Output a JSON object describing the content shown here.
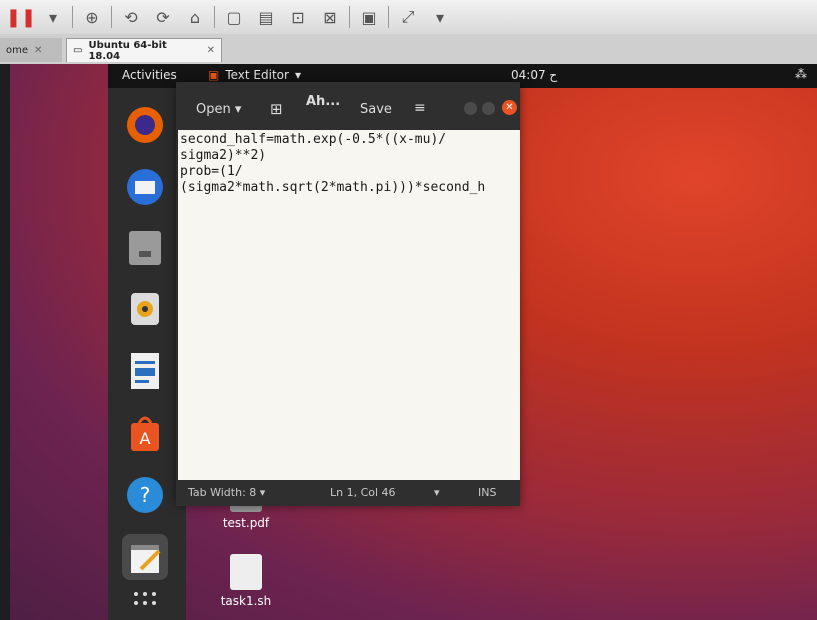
{
  "vmware": {
    "tabs": [
      {
        "label": "ome"
      },
      {
        "label": "Ubuntu 64-bit 18.04"
      }
    ]
  },
  "ubuntu": {
    "topbar": {
      "activities": "Activities",
      "app_name": "Text Editor",
      "app_arrow": "▾",
      "clock": "04:07",
      "clock_suffix": "ح"
    }
  },
  "editor": {
    "open_label": "Open",
    "title": "Ah...",
    "save_label": "Save",
    "lines": [
      "second_half=math.exp(-0.5*((x-mu)/",
      "sigma2)**2)",
      "prob=(1/",
      "(sigma2*math.sqrt(2*math.pi)))*second_h"
    ],
    "status": {
      "tab_width": "Tab Width: 8",
      "position": "Ln 1, Col 46",
      "mode": "INS"
    }
  },
  "desktop": {
    "files": [
      {
        "name": "test.pdf"
      },
      {
        "name": "task1.sh"
      }
    ]
  },
  "colors": {
    "ubuntu_orange": "#e95420",
    "desktop_bg": "#c2331f",
    "dock": "#2c2c2c"
  }
}
